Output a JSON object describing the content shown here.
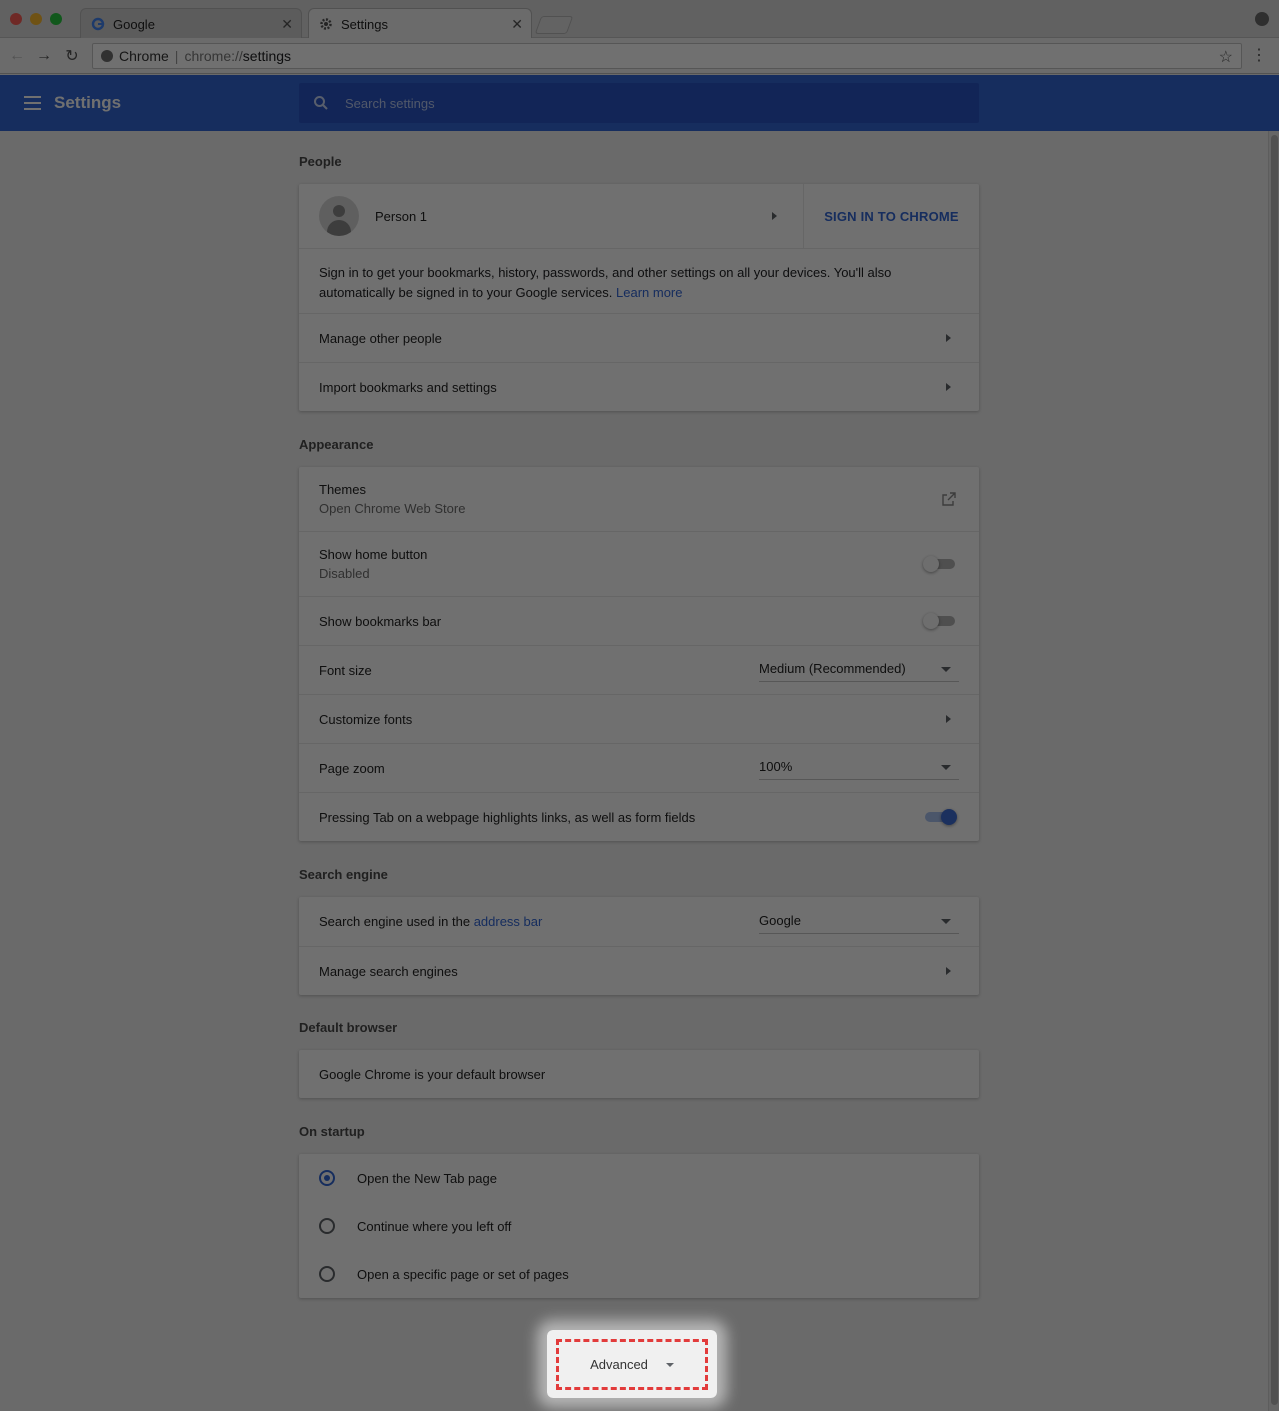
{
  "browser": {
    "tabs": [
      {
        "title": "Google",
        "icon": "google-g-icon"
      },
      {
        "title": "Settings",
        "icon": "gear-icon"
      }
    ],
    "omnibox": {
      "origin": "Chrome",
      "url_scheme": "chrome://",
      "url_path": "settings"
    }
  },
  "header": {
    "title": "Settings",
    "search_placeholder": "Search settings"
  },
  "people": {
    "title": "People",
    "person_name": "Person 1",
    "sign_in_button": "SIGN IN TO CHROME",
    "sign_in_text": "Sign in to get your bookmarks, history, passwords, and other settings on all your devices. You'll also automatically be signed in to your Google services.",
    "learn_more": "Learn more",
    "manage_other_people": "Manage other people",
    "import_bookmarks": "Import bookmarks and settings"
  },
  "appearance": {
    "title": "Appearance",
    "themes_label": "Themes",
    "themes_sub": "Open Chrome Web Store",
    "home_button_label": "Show home button",
    "home_button_sub": "Disabled",
    "home_button_enabled": false,
    "bookmarks_bar_label": "Show bookmarks bar",
    "bookmarks_bar_enabled": false,
    "font_size_label": "Font size",
    "font_size_value": "Medium (Recommended)",
    "customize_fonts": "Customize fonts",
    "page_zoom_label": "Page zoom",
    "page_zoom_value": "100%",
    "tab_highlight_label": "Pressing Tab on a webpage highlights links, as well as form fields",
    "tab_highlight_enabled": true
  },
  "search_engine": {
    "title": "Search engine",
    "used_label": "Search engine used in the",
    "used_link": "address bar",
    "value": "Google",
    "manage": "Manage search engines"
  },
  "default_browser": {
    "title": "Default browser",
    "status": "Google Chrome is your default browser"
  },
  "on_startup": {
    "title": "On startup",
    "options": [
      {
        "label": "Open the New Tab page",
        "checked": true
      },
      {
        "label": "Continue where you left off",
        "checked": false
      },
      {
        "label": "Open a specific page or set of pages",
        "checked": false
      }
    ]
  },
  "advanced": {
    "label": "Advanced"
  },
  "colors": {
    "accent": "#3367d6",
    "highlight_border": "#e23b3b"
  }
}
